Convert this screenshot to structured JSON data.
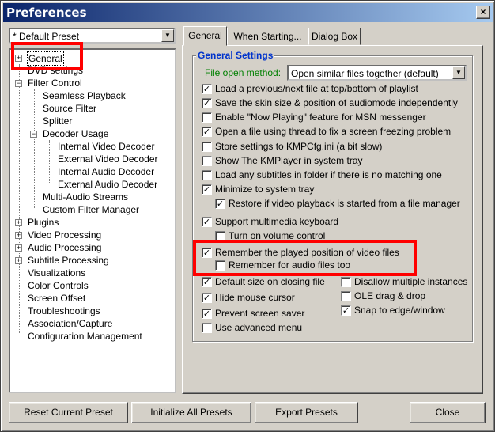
{
  "window": {
    "title": "Preferences",
    "close_glyph": "×"
  },
  "preset": {
    "value": "* Default Preset",
    "arrow": "▼"
  },
  "tree": {
    "items": [
      {
        "label": "General",
        "expander": "+"
      },
      {
        "label": "DVD settings",
        "expander": ""
      },
      {
        "label": "Filter Control",
        "expander": "−"
      },
      {
        "label": "Seamless Playback",
        "expander": ""
      },
      {
        "label": "Source Filter",
        "expander": ""
      },
      {
        "label": "Splitter",
        "expander": ""
      },
      {
        "label": "Decoder Usage",
        "expander": "−"
      },
      {
        "label": "Internal Video Decoder",
        "expander": ""
      },
      {
        "label": "External Video Decoder",
        "expander": ""
      },
      {
        "label": "Internal Audio Decoder",
        "expander": ""
      },
      {
        "label": "External Audio Decoder",
        "expander": ""
      },
      {
        "label": "Multi-Audio Streams",
        "expander": ""
      },
      {
        "label": "Custom Filter Manager",
        "expander": ""
      },
      {
        "label": "Plugins",
        "expander": "+"
      },
      {
        "label": "Video Processing",
        "expander": "+"
      },
      {
        "label": "Audio Processing",
        "expander": "+"
      },
      {
        "label": "Subtitle Processing",
        "expander": "+"
      },
      {
        "label": "Visualizations",
        "expander": ""
      },
      {
        "label": "Color Controls",
        "expander": ""
      },
      {
        "label": "Screen Offset",
        "expander": ""
      },
      {
        "label": "Troubleshootings",
        "expander": ""
      },
      {
        "label": "Association/Capture",
        "expander": ""
      },
      {
        "label": "Configuration Management",
        "expander": ""
      }
    ]
  },
  "tabs": [
    {
      "label": "General"
    },
    {
      "label": "When Starting..."
    },
    {
      "label": "Dialog Box"
    }
  ],
  "general": {
    "group_title": "General Settings",
    "open_method_label": "File open method:",
    "open_method_value": "Open similar files together (default)",
    "dropdown_arrow": "▼",
    "check_glyph": "✓",
    "options": [
      {
        "label": "Load a previous/next file at top/bottom of playlist",
        "checked": true
      },
      {
        "label": "Save the skin size & position of audiomode independently",
        "checked": true
      },
      {
        "label": "Enable \"Now Playing\" feature for MSN messenger",
        "checked": false
      },
      {
        "label": "Open a file using thread to fix a screen freezing problem",
        "checked": true
      },
      {
        "label": "Store settings to KMPCfg.ini (a bit slow)",
        "checked": false
      },
      {
        "label": "Show The KMPlayer in system tray",
        "checked": false
      },
      {
        "label": "Load any subtitles in folder if there is no matching one",
        "checked": false
      },
      {
        "label": "Minimize to system tray",
        "checked": true
      },
      {
        "label": "Restore if video playback is started from a file manager",
        "checked": true
      },
      {
        "label": "Support multimedia keyboard",
        "checked": true
      },
      {
        "label": "Turn on volume control",
        "checked": false
      },
      {
        "label": "Remember the played position of video files",
        "checked": true
      },
      {
        "label": "Remember for audio files too",
        "checked": false
      },
      {
        "label": "Default size on closing file",
        "checked": true
      },
      {
        "label": "Hide mouse cursor",
        "checked": true
      },
      {
        "label": "Prevent screen saver",
        "checked": true
      },
      {
        "label": "Use advanced menu",
        "checked": false
      },
      {
        "label": "Disallow multiple instances",
        "checked": false
      },
      {
        "label": "OLE drag & drop",
        "checked": false
      },
      {
        "label": "Snap to edge/window",
        "checked": true
      }
    ]
  },
  "buttons": {
    "reset": "Reset Current Preset",
    "initialize": "Initialize All Presets",
    "export": "Export Presets",
    "close": "Close"
  },
  "colors": {
    "highlight": "#ff0000",
    "group_title": "#0033cc",
    "green_label": "#008000",
    "titlebar": "#0a246a"
  }
}
